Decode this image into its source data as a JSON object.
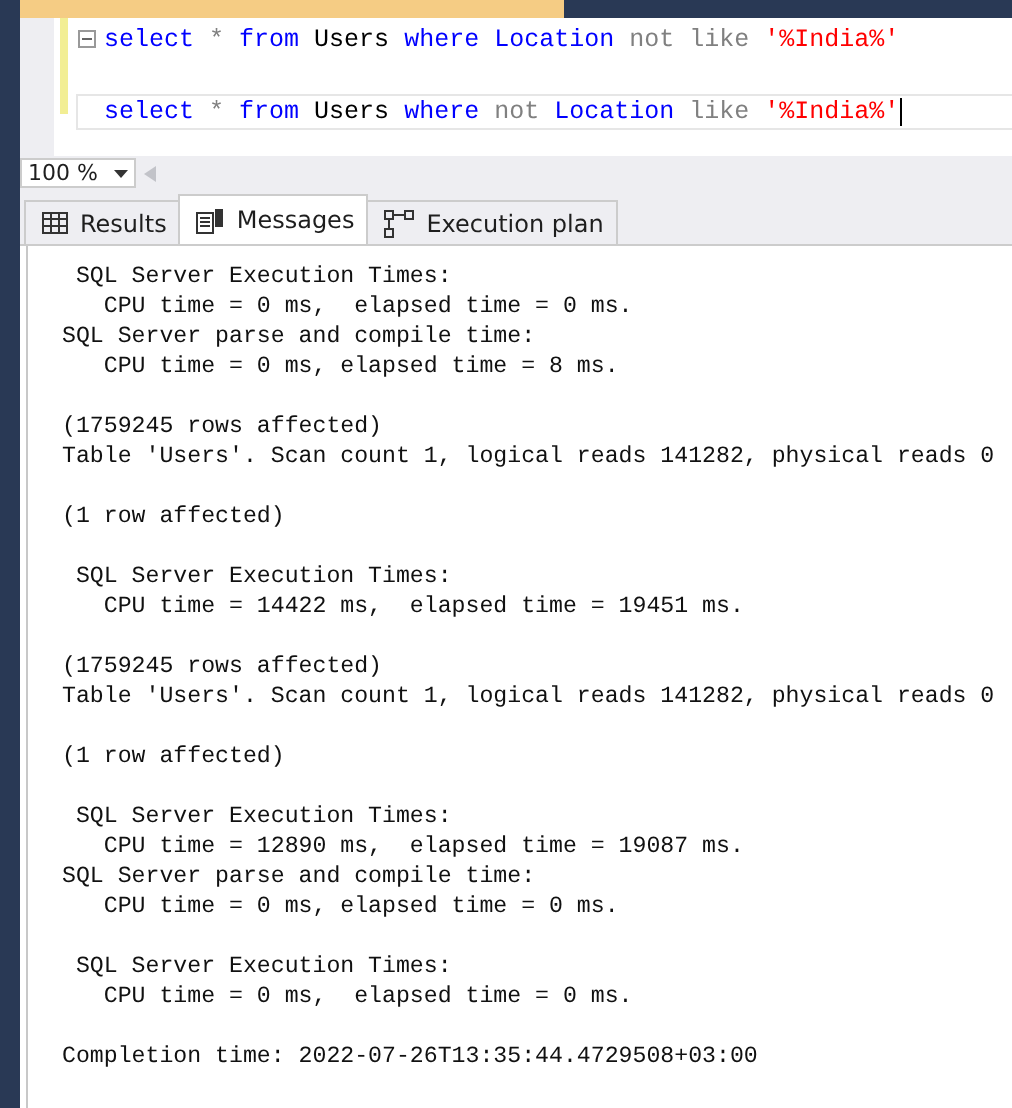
{
  "editor": {
    "lines": [
      {
        "tokens": [
          {
            "kind": "keyword",
            "text": "select"
          },
          {
            "kind": "operator",
            "text": "*"
          },
          {
            "kind": "keyword",
            "text": "from"
          },
          {
            "kind": "identifier",
            "text": "Users"
          },
          {
            "kind": "keyword",
            "text": "where"
          },
          {
            "kind": "keyword",
            "text": "Location"
          },
          {
            "kind": "operator",
            "text": "not"
          },
          {
            "kind": "operator",
            "text": "like"
          },
          {
            "kind": "string",
            "text": "'%India%'"
          }
        ],
        "collapsible": true,
        "current": false
      },
      {
        "collapsible": false,
        "current": false
      },
      {
        "tokens": [
          {
            "kind": "keyword",
            "text": "select"
          },
          {
            "kind": "operator",
            "text": "*"
          },
          {
            "kind": "keyword",
            "text": "from"
          },
          {
            "kind": "identifier",
            "text": "Users"
          },
          {
            "kind": "keyword",
            "text": "where"
          },
          {
            "kind": "operator",
            "text": "not"
          },
          {
            "kind": "keyword",
            "text": "Location"
          },
          {
            "kind": "operator",
            "text": "like"
          },
          {
            "kind": "string",
            "text": "'%India%'"
          }
        ],
        "collapsible": false,
        "current": true
      }
    ]
  },
  "zoom": {
    "value": "100 %"
  },
  "tabs": [
    {
      "label": "Results",
      "selected": false
    },
    {
      "label": "Messages",
      "selected": true
    },
    {
      "label": "Execution plan",
      "selected": false
    }
  ],
  "messages": [
    [
      " SQL Server Execution Times:",
      "   CPU time = 0 ms,  elapsed time = 0 ms.",
      "SQL Server parse and compile time:",
      "   CPU time = 0 ms, elapsed time = 8 ms."
    ],
    [
      "(1759245 rows affected)",
      "Table 'Users'. Scan count 1, logical reads 141282, physical reads 0"
    ],
    [
      "(1 row affected)"
    ],
    [
      " SQL Server Execution Times:",
      "   CPU time = 14422 ms,  elapsed time = 19451 ms."
    ],
    [
      "(1759245 rows affected)",
      "Table 'Users'. Scan count 1, logical reads 141282, physical reads 0"
    ],
    [
      "(1 row affected)"
    ],
    [
      " SQL Server Execution Times:",
      "   CPU time = 12890 ms,  elapsed time = 19087 ms.",
      "SQL Server parse and compile time:",
      "   CPU time = 0 ms, elapsed time = 0 ms."
    ],
    [
      " SQL Server Execution Times:",
      "   CPU time = 0 ms,  elapsed time = 0 ms."
    ],
    [
      "Completion time: 2022-07-26T13:35:44.4729508+03:00"
    ]
  ]
}
